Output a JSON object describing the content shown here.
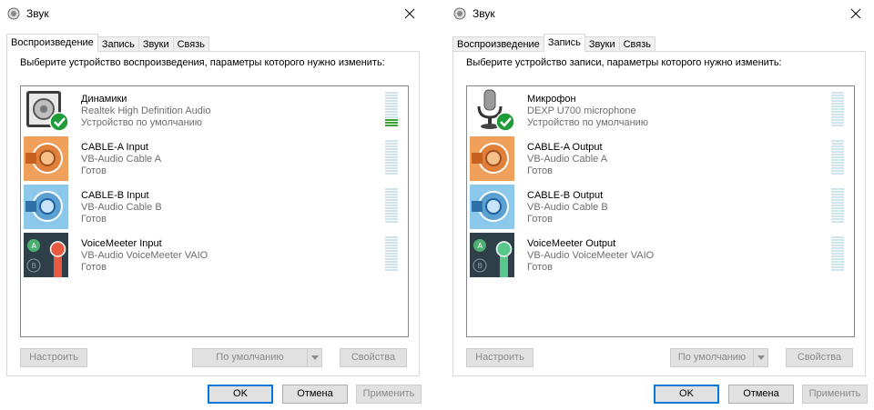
{
  "windows": [
    {
      "title": "Звук",
      "tabs": [
        {
          "label": "Воспроизведение",
          "active": true
        },
        {
          "label": "Запись",
          "active": false
        },
        {
          "label": "Звуки",
          "active": false
        },
        {
          "label": "Связь",
          "active": false
        }
      ],
      "instruction": "Выберите устройство воспроизведения, параметры которого нужно изменить:",
      "devices": [
        {
          "name": "Динамики",
          "driver": "Realtek High Definition Audio",
          "status": "Устройство по умолчанию",
          "icon": "speaker-icon",
          "default": true,
          "level": 0.25
        },
        {
          "name": "CABLE-A Input",
          "driver": "VB-Audio Cable A",
          "status": "Готов",
          "icon": "cable-a-icon",
          "default": false,
          "level": 0
        },
        {
          "name": "CABLE-B Input",
          "driver": "VB-Audio Cable B",
          "status": "Готов",
          "icon": "cable-b-icon",
          "default": false,
          "level": 0
        },
        {
          "name": "VoiceMeeter Input",
          "driver": "VB-Audio VoiceMeeter VAIO",
          "status": "Готов",
          "icon": "voicemeeter-input-icon",
          "default": false,
          "level": 0
        }
      ],
      "buttons": {
        "configure": "Настроить",
        "set_default": "По умолчанию",
        "properties": "Свойства",
        "ok": "OK",
        "cancel": "Отмена",
        "apply": "Применить"
      }
    },
    {
      "title": "Звук",
      "tabs": [
        {
          "label": "Воспроизведение",
          "active": false
        },
        {
          "label": "Запись",
          "active": true
        },
        {
          "label": "Звуки",
          "active": false
        },
        {
          "label": "Связь",
          "active": false
        }
      ],
      "instruction": "Выберите устройство записи, параметры которого нужно изменить:",
      "devices": [
        {
          "name": "Микрофон",
          "driver": "DEXP U700 microphone",
          "status": "Устройство по умолчанию",
          "icon": "microphone-icon",
          "default": true,
          "level": 0
        },
        {
          "name": "CABLE-A Output",
          "driver": "VB-Audio Cable A",
          "status": "Готов",
          "icon": "cable-a-icon",
          "default": false,
          "level": 0
        },
        {
          "name": "CABLE-B Output",
          "driver": "VB-Audio Cable B",
          "status": "Готов",
          "icon": "cable-b-icon",
          "default": false,
          "level": 0
        },
        {
          "name": "VoiceMeeter Output",
          "driver": "VB-Audio VoiceMeeter VAIO",
          "status": "Готов",
          "icon": "voicemeeter-output-icon",
          "default": false,
          "level": 0
        }
      ],
      "buttons": {
        "configure": "Настроить",
        "set_default": "По умолчанию",
        "properties": "Свойства",
        "ok": "OK",
        "cancel": "Отмена",
        "apply": "Применить"
      }
    }
  ],
  "colors": {
    "accent": "#0078d7",
    "check_green": "#1f9c3a",
    "meter_on": "#3aa03a",
    "meter_off": "#cfe3ec",
    "cable_a": "#f0a05a",
    "cable_b": "#8cc8ec",
    "voicemeeter_bg": "#2f3f4a"
  }
}
